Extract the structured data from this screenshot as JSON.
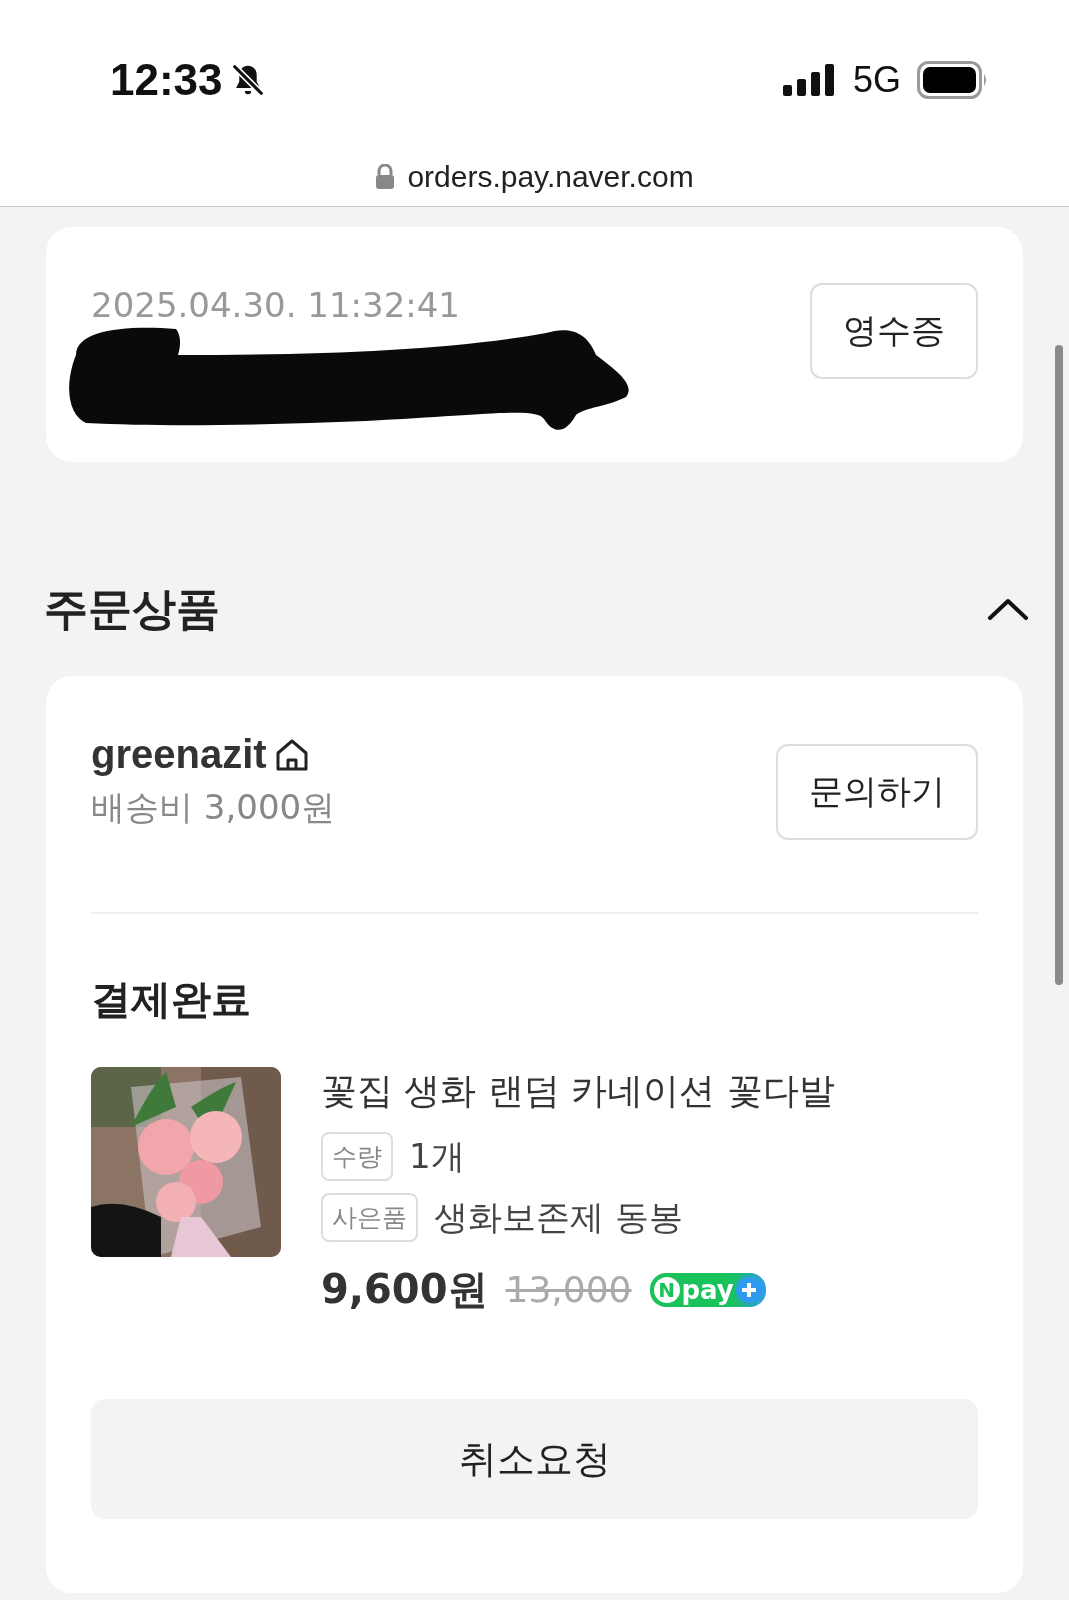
{
  "status_bar": {
    "time": "12:33",
    "network": "5G",
    "silent": true
  },
  "address_bar": {
    "url": "orders.pay.naver.com",
    "secure": true
  },
  "order_card": {
    "datetime": "2025.04.30. 11:32:41",
    "receipt_button": "영수증"
  },
  "section": {
    "title": "주문상품",
    "expanded": true
  },
  "seller": {
    "name": "greenazit",
    "shipping": "배송비 3,000원",
    "inquiry_button": "문의하기"
  },
  "order_status": "결제완료",
  "product": {
    "kind": "picture",
    "title": "꽃집 생화 랜덤 카네이션 꽃다발",
    "details": [
      {
        "tag": "수량",
        "value": "1개"
      },
      {
        "tag": "사은품",
        "value": "생화보존제 동봉"
      }
    ],
    "price": "9,600원",
    "original_price": "13,000",
    "badge": {
      "logo_letter": "N",
      "label": "pay"
    }
  },
  "cancel_button": "취소요청"
}
